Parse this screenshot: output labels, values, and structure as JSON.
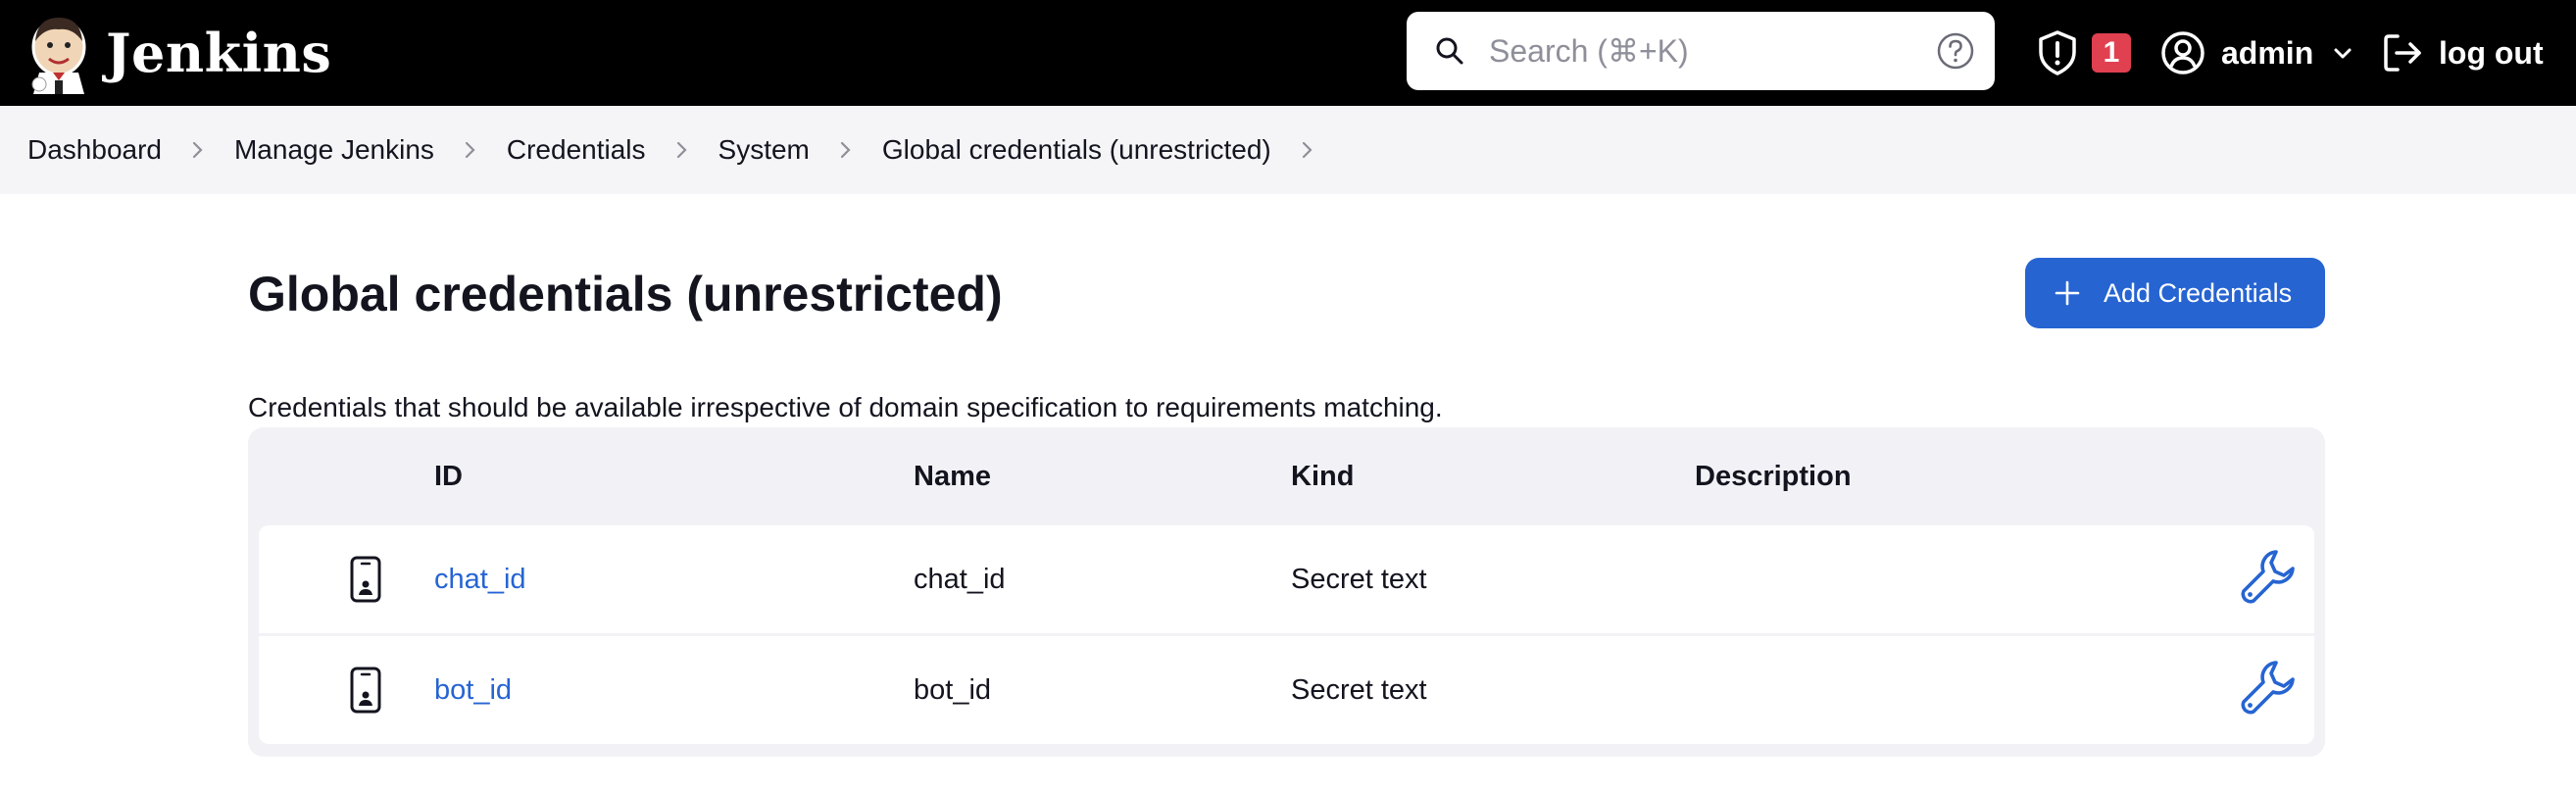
{
  "header": {
    "brand_name": "Jenkins",
    "search": {
      "placeholder": "Search (⌘+K)",
      "value": ""
    },
    "security_badge_count": "1",
    "user_name": "admin",
    "logout_label": "log out"
  },
  "breadcrumb": [
    {
      "label": "Dashboard"
    },
    {
      "label": "Manage Jenkins"
    },
    {
      "label": "Credentials"
    },
    {
      "label": "System"
    },
    {
      "label": "Global credentials (unrestricted)"
    }
  ],
  "main": {
    "title": "Global credentials (unrestricted)",
    "add_button_label": "Add Credentials",
    "description": "Credentials that should be available irrespective of domain specification to requirements matching.",
    "table": {
      "columns": [
        "ID",
        "Name",
        "Kind",
        "Description"
      ],
      "rows": [
        {
          "id": "chat_id",
          "name": "chat_id",
          "kind": "Secret text",
          "description": ""
        },
        {
          "id": "bot_id",
          "name": "bot_id",
          "kind": "Secret text",
          "description": ""
        }
      ]
    }
  },
  "icons": {
    "logo": "jenkins-butler-logo",
    "search": "search-icon",
    "help": "help-icon",
    "security": "shield-icon",
    "user": "user-icon",
    "chevron": "chevron-down-icon",
    "logout": "logout-icon",
    "breadcrumb_separator": "chevron-right-icon",
    "add": "plus-icon",
    "credential": "phone-id-icon",
    "configure": "wrench-icon"
  },
  "colors": {
    "header_bg": "#000000",
    "accent": "#2664d2",
    "badge": "#e04050",
    "breadcrumb_bg": "#f5f5f7",
    "table_bg": "#f2f2f6"
  }
}
